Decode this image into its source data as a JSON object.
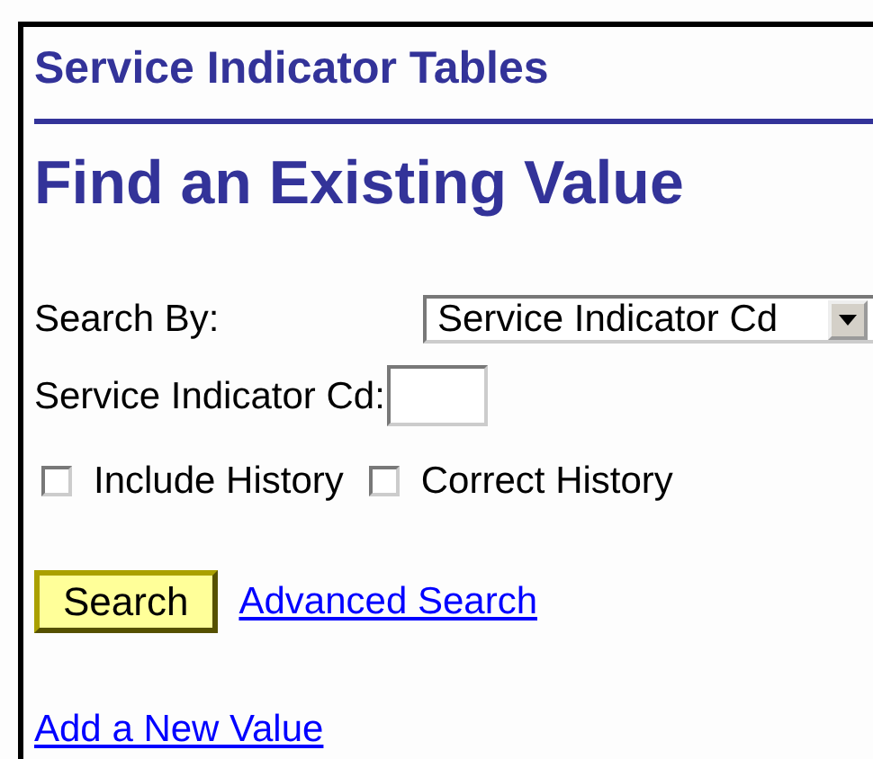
{
  "page_title": "Service Indicator Tables",
  "heading": "Find an Existing Value",
  "search_by": {
    "label": "Search By:",
    "value": "Service Indicator Cd"
  },
  "field": {
    "label": "Service Indicator Cd:"
  },
  "checkboxes": [
    {
      "label": "Include History",
      "checked": false
    },
    {
      "label": "Correct History",
      "checked": false
    }
  ],
  "search_button": "Search",
  "advanced_link": "Advanced Search",
  "add_link": "Add a New Value"
}
